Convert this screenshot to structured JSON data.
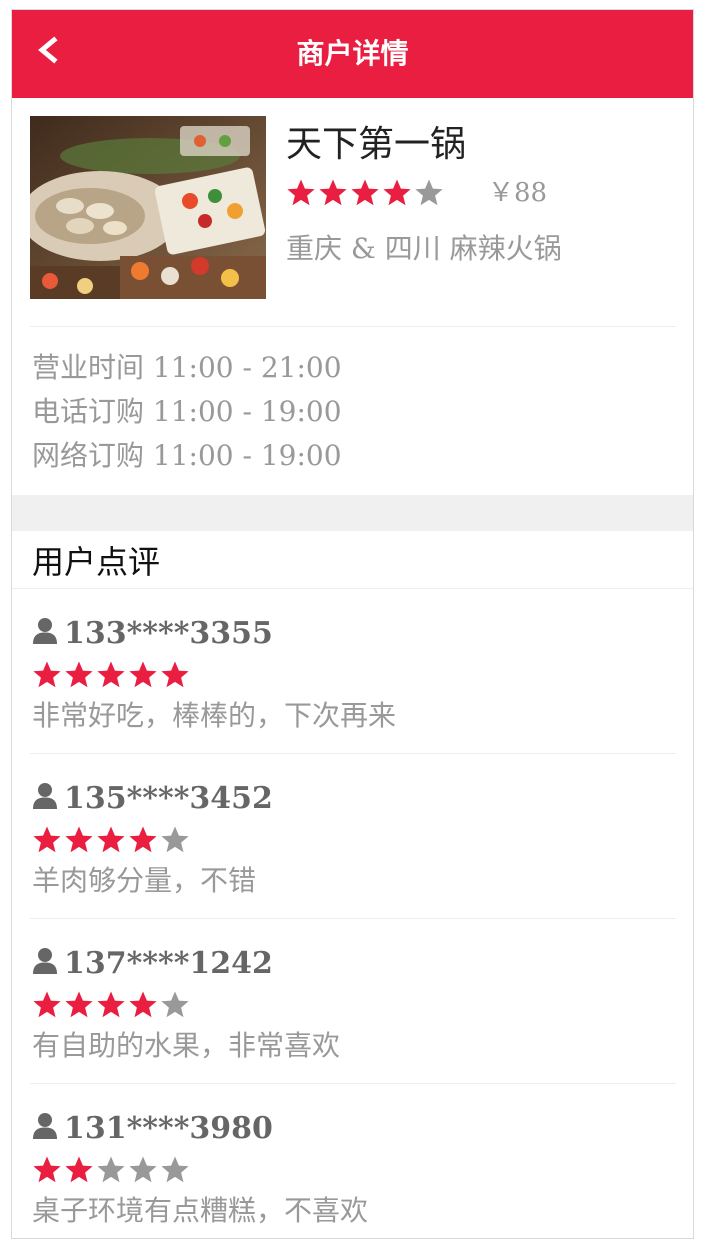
{
  "navbar": {
    "title": "商户详情",
    "back_icon": "chevron-left-icon"
  },
  "merchant": {
    "name": "天下第一锅",
    "rating": 4,
    "rating_max": 5,
    "price": "￥88",
    "category": "重庆 & 四川 麻辣火锅",
    "hours": [
      "营业时间 11:00 - 21:00",
      "电话订购 11:00 - 19:00",
      "网络订购 11:00 - 19:00"
    ]
  },
  "reviews_section": {
    "heading": "用户点评",
    "user_icon": "user-icon",
    "items": [
      {
        "user": "133****3355",
        "rating": 5,
        "text": "非常好吃，棒棒的，下次再来"
      },
      {
        "user": "135****3452",
        "rating": 4,
        "text": "羊肉够分量，不错"
      },
      {
        "user": "137****1242",
        "rating": 4,
        "text": "有自助的水果，非常喜欢"
      },
      {
        "user": "131****3980",
        "rating": 2,
        "text": "桌子环境有点糟糕，不喜欢"
      }
    ]
  },
  "colors": {
    "brand": "#e91e40",
    "star_on": "#e91e40",
    "star_off": "#999999",
    "muted_text": "#999999"
  }
}
